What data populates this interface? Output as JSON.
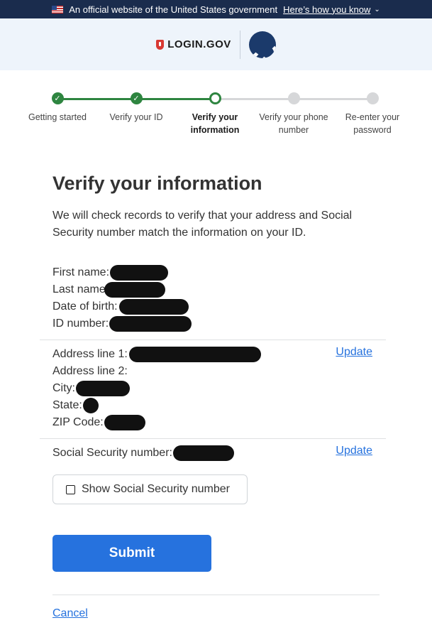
{
  "gov_banner": {
    "text": "An official website of the United States government",
    "link": "Here’s how you know",
    "icons": [
      "us-flag-icon",
      "chevron-down-icon"
    ]
  },
  "header": {
    "logo_text": "LOGIN.GOV",
    "partner_seal": "department-of-transportation-seal-icon",
    "brand_color": "#d83933"
  },
  "steps": [
    {
      "label": "Getting started",
      "status": "complete"
    },
    {
      "label": "Verify your ID",
      "status": "complete"
    },
    {
      "label": "Verify your information",
      "status": "current"
    },
    {
      "label": "Verify your phone number",
      "status": "incomplete"
    },
    {
      "label": "Re-enter your password",
      "status": "incomplete"
    }
  ],
  "page": {
    "title": "Verify your information",
    "intro": "We will check records to verify that your address and Social Security number match the information on your ID."
  },
  "identity": {
    "first_name_label": "First name:",
    "last_name_label": "Last name:",
    "dob_label": "Date of birth:",
    "id_number_label": "ID number:"
  },
  "address": {
    "line1_label": "Address line 1:",
    "line2_label": "Address line 2:",
    "city_label": "City:",
    "state_label": "State:",
    "zip_label": "ZIP Code:",
    "update_label": "Update"
  },
  "ssn": {
    "label": "Social Security number:",
    "update_label": "Update",
    "show_label": "Show Social Security number"
  },
  "actions": {
    "submit_label": "Submit",
    "cancel_label": "Cancel"
  },
  "colors": {
    "accent": "#2672de",
    "success": "#2e8540",
    "banner": "#1a2c4d",
    "header_bg": "#eef4fb"
  }
}
